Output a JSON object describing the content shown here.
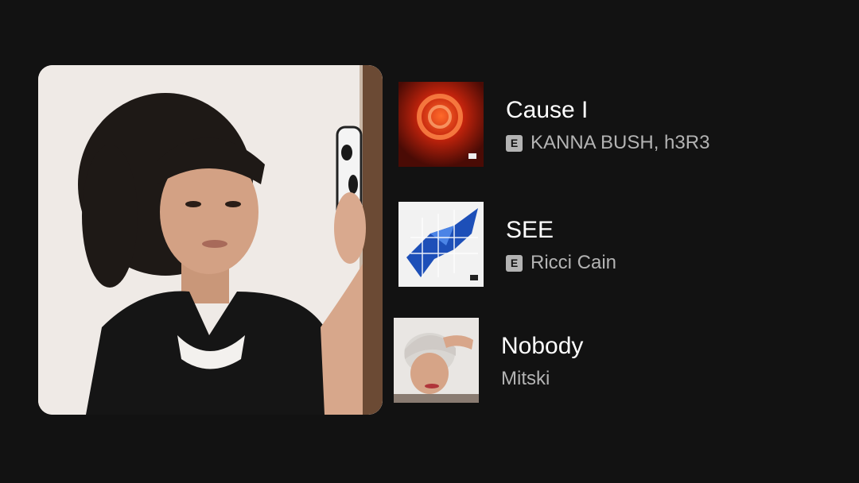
{
  "tracks": [
    {
      "title": "Cause I",
      "artist": "KANNA BUSH, h3R3",
      "explicit": true,
      "explicit_label": "E",
      "cover_icon": "album-cover-red-swirl"
    },
    {
      "title": "SEE",
      "artist": "Ricci Cain",
      "explicit": true,
      "explicit_label": "E",
      "cover_icon": "album-cover-blue-bird"
    },
    {
      "title": "Nobody",
      "artist": "Mitski",
      "explicit": false,
      "cover_icon": "album-cover-mitski-portrait"
    }
  ],
  "colors": {
    "background": "#121212",
    "title": "#ffffff",
    "subtitle": "#b3b3b3"
  }
}
